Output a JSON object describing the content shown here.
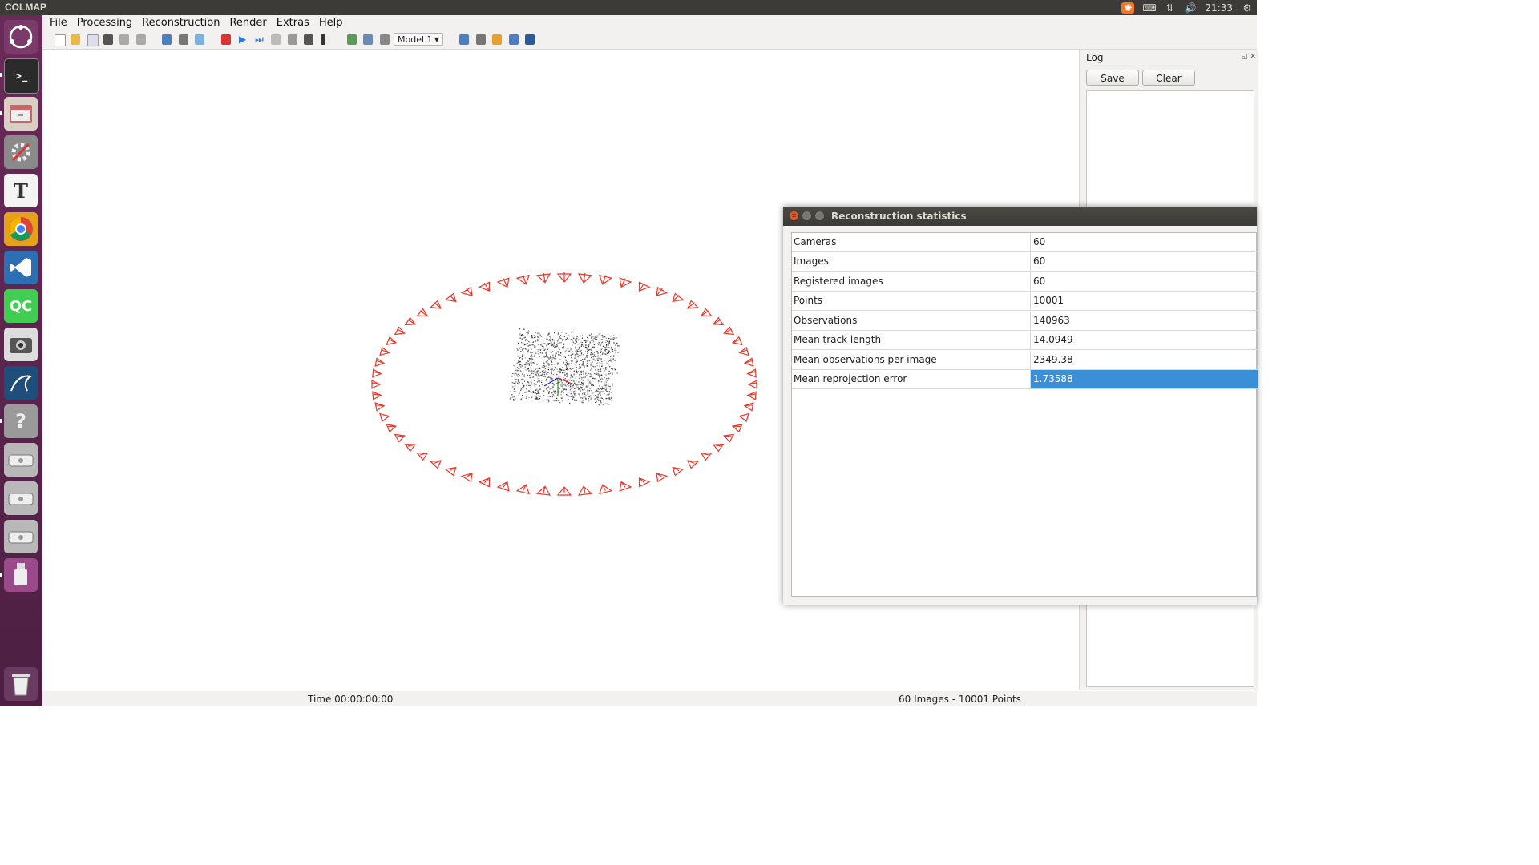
{
  "topbar": {
    "app_title": "COLMAP",
    "clock": "21:33"
  },
  "menu": [
    "File",
    "Processing",
    "Reconstruction",
    "Render",
    "Extras",
    "Help"
  ],
  "toolbar": {
    "model_select": "Model 1"
  },
  "log": {
    "title": "Log",
    "save_label": "Save",
    "clear_label": "Clear"
  },
  "stats": {
    "title": "Reconstruction statistics",
    "rows": [
      {
        "label": "Cameras",
        "value": "60"
      },
      {
        "label": "Images",
        "value": "60"
      },
      {
        "label": "Registered images",
        "value": "60"
      },
      {
        "label": "Points",
        "value": "10001"
      },
      {
        "label": "Observations",
        "value": "140963"
      },
      {
        "label": "Mean track length",
        "value": "14.0949"
      },
      {
        "label": "Mean observations per image",
        "value": "2349.38"
      },
      {
        "label": "Mean reprojection error",
        "value": "1.73588"
      }
    ]
  },
  "status": {
    "time": "Time 00:00:00:00",
    "counts": "60 Images - 10001 Points"
  },
  "colors": {
    "camera": "#e8382c",
    "selection": "#3a8fd6",
    "launcher": "#5e2750"
  },
  "launcher_icons": [
    "ubuntu-dash-icon",
    "terminal-icon",
    "file-manager-icon",
    "system-settings-icon",
    "text-editor-icon",
    "chrome-icon",
    "vscode-icon",
    "qtcreator-icon",
    "screenshot-icon",
    "mysql-workbench-icon",
    "help-icon",
    "drive-icon",
    "drive-icon",
    "drive-icon",
    "usb-icon",
    "trash-icon"
  ]
}
